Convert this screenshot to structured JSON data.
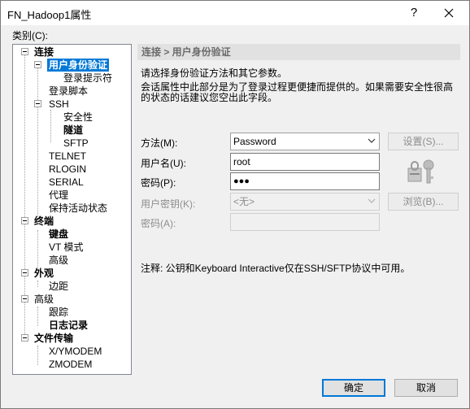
{
  "window": {
    "title": "FN_Hadoop1属性",
    "help_label": "?",
    "close_icon": "close-icon"
  },
  "category_label": "类别(C):",
  "tree": [
    {
      "label": "连接",
      "bold": true
    },
    {
      "label": "用户身份验证",
      "bold": true,
      "selected": true
    },
    {
      "label": "登录提示符",
      "bold": false
    },
    {
      "label": "登录脚本",
      "bold": false
    },
    {
      "label": "SSH",
      "bold": false
    },
    {
      "label": "安全性",
      "bold": false
    },
    {
      "label": "隧道",
      "bold": true
    },
    {
      "label": "SFTP",
      "bold": false
    },
    {
      "label": "TELNET",
      "bold": false
    },
    {
      "label": "RLOGIN",
      "bold": false
    },
    {
      "label": "SERIAL",
      "bold": false
    },
    {
      "label": "代理",
      "bold": false
    },
    {
      "label": "保持活动状态",
      "bold": false
    },
    {
      "label": "终端",
      "bold": true
    },
    {
      "label": "键盘",
      "bold": true
    },
    {
      "label": "VT 模式",
      "bold": false
    },
    {
      "label": "高级",
      "bold": false
    },
    {
      "label": "外观",
      "bold": true
    },
    {
      "label": "边距",
      "bold": false
    },
    {
      "label": "高级",
      "bold": false
    },
    {
      "label": "跟踪",
      "bold": false
    },
    {
      "label": "日志记录",
      "bold": true
    },
    {
      "label": "文件传输",
      "bold": true
    },
    {
      "label": "X/YMODEM",
      "bold": false
    },
    {
      "label": "ZMODEM",
      "bold": false
    }
  ],
  "panel": {
    "header": "连接 > 用户身份验证",
    "desc1": "请选择身份验证方法和其它参数。",
    "desc2": "会话属性中此部分是为了登录过程更便捷而提供的。如果需要安全性很高",
    "desc3": "的状态的话建议您空出此字段。",
    "method_label": "方法(M):",
    "method_value": "Password",
    "settings_button": "设置(S)...",
    "username_label": "用户名(U):",
    "username_value": "root",
    "password_label": "密码(P):",
    "password_value": "●●●",
    "userkey_label": "用户密钥(K):",
    "userkey_value": "<无>",
    "browse_button": "浏览(B)...",
    "passphrase_label": "密码(A):",
    "note": "注释: 公钥和Keyboard Interactive仅在SSH/SFTP协议中可用。"
  },
  "footer": {
    "ok": "确定",
    "cancel": "取消"
  }
}
